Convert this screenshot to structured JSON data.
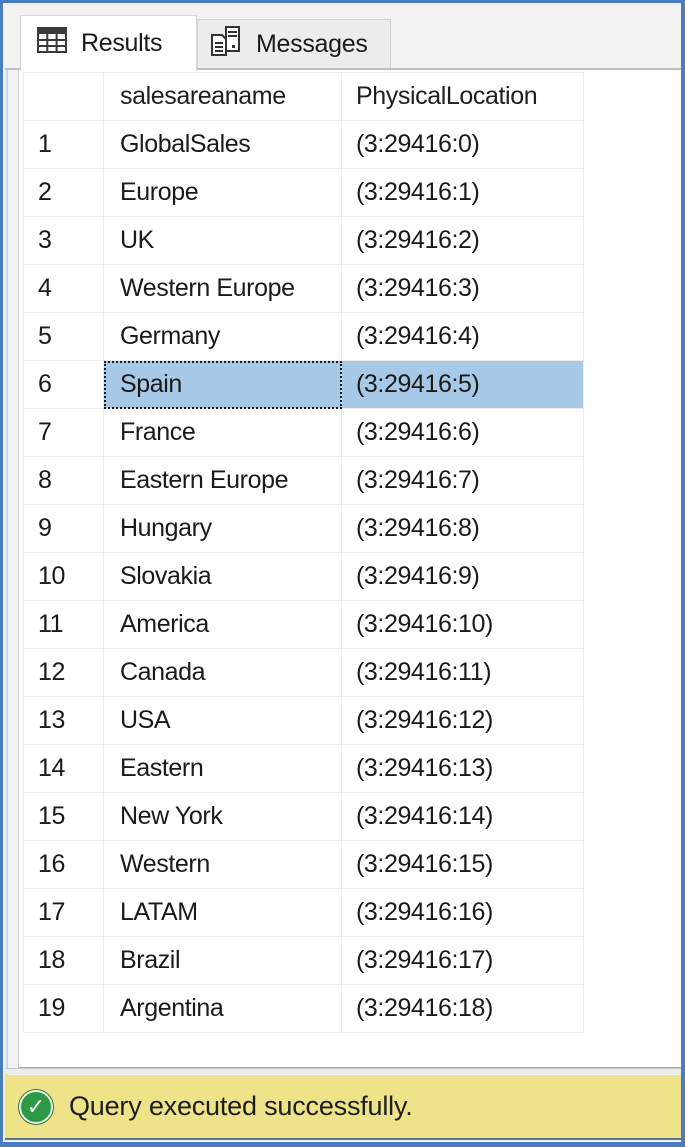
{
  "tabs": [
    {
      "label": "Results",
      "icon": "grid-table-icon",
      "active": true
    },
    {
      "label": "Messages",
      "icon": "messages-document-server-icon",
      "active": false
    }
  ],
  "grid": {
    "columns": [
      "",
      "salesareaname",
      "PhysicalLocation"
    ],
    "selected_row": 6,
    "rows": [
      {
        "num": "1",
        "salesareaname": "GlobalSales",
        "location": "(3:29416:0)"
      },
      {
        "num": "2",
        "salesareaname": "Europe",
        "location": "(3:29416:1)"
      },
      {
        "num": "3",
        "salesareaname": "UK",
        "location": "(3:29416:2)"
      },
      {
        "num": "4",
        "salesareaname": "Western Europe",
        "location": "(3:29416:3)"
      },
      {
        "num": "5",
        "salesareaname": "Germany",
        "location": "(3:29416:4)"
      },
      {
        "num": "6",
        "salesareaname": "Spain",
        "location": "(3:29416:5)"
      },
      {
        "num": "7",
        "salesareaname": "France",
        "location": "(3:29416:6)"
      },
      {
        "num": "8",
        "salesareaname": "Eastern Europe",
        "location": "(3:29416:7)"
      },
      {
        "num": "9",
        "salesareaname": "Hungary",
        "location": "(3:29416:8)"
      },
      {
        "num": "10",
        "salesareaname": "Slovakia",
        "location": "(3:29416:9)"
      },
      {
        "num": "11",
        "salesareaname": "America",
        "location": "(3:29416:10)"
      },
      {
        "num": "12",
        "salesareaname": "Canada",
        "location": "(3:29416:11)"
      },
      {
        "num": "13",
        "salesareaname": "USA",
        "location": "(3:29416:12)"
      },
      {
        "num": "14",
        "salesareaname": "Eastern",
        "location": "(3:29416:13)"
      },
      {
        "num": "15",
        "salesareaname": "New York",
        "location": "(3:29416:14)"
      },
      {
        "num": "16",
        "salesareaname": "Western",
        "location": "(3:29416:15)"
      },
      {
        "num": "17",
        "salesareaname": "LATAM",
        "location": "(3:29416:16)"
      },
      {
        "num": "18",
        "salesareaname": "Brazil",
        "location": "(3:29416:17)"
      },
      {
        "num": "19",
        "salesareaname": "Argentina",
        "location": "(3:29416:18)"
      }
    ]
  },
  "status": {
    "icon": "success-check-icon",
    "icon_glyph": "✓",
    "text": "Query executed successfully.",
    "color": "#efe38a"
  },
  "colors": {
    "frame": "#4a7cc0",
    "selection": "#a8c8e8",
    "success": "#2f9a45"
  }
}
